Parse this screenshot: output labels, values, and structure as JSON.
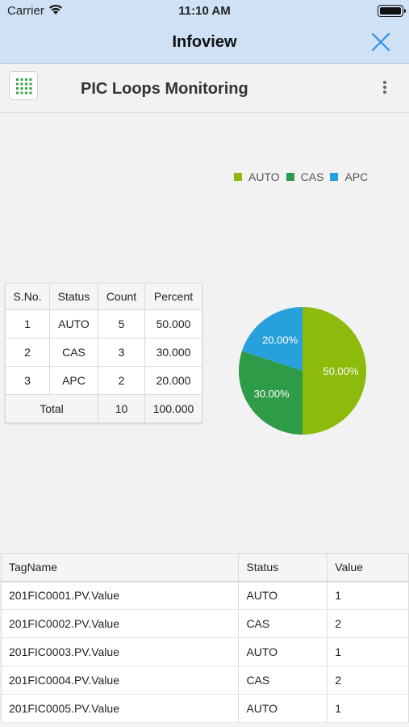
{
  "status_bar": {
    "carrier": "Carrier",
    "time": "11:10 AM"
  },
  "nav": {
    "title": "Infoview",
    "close_icon": "close-icon"
  },
  "header": {
    "title": "PIC Loops Monitoring",
    "grid_icon": "grid-icon",
    "more_icon": "more-vertical-icon"
  },
  "colors": {
    "auto": "#8dbb0b",
    "cas": "#2e9b48",
    "apc": "#27a0dc",
    "nav_bg": "#cfe1f5",
    "accent": "#2f8fe3"
  },
  "summary": {
    "headers": [
      "S.No.",
      "Status",
      "Count",
      "Percent"
    ],
    "rows": [
      {
        "sno": "1",
        "status": "AUTO",
        "count": "5",
        "percent": "50.000"
      },
      {
        "sno": "2",
        "status": "CAS",
        "count": "3",
        "percent": "30.000"
      },
      {
        "sno": "3",
        "status": "APC",
        "count": "2",
        "percent": "20.000"
      }
    ],
    "total": {
      "label": "Total",
      "count": "10",
      "percent": "100.000"
    }
  },
  "chart_data": {
    "type": "pie",
    "categories": [
      "AUTO",
      "CAS",
      "APC"
    ],
    "values": [
      50,
      30,
      20
    ],
    "labels": [
      "50.00%",
      "30.00%",
      "20.00%"
    ],
    "legend": "top",
    "colors": [
      "#8dbb0b",
      "#2e9b48",
      "#27a0dc"
    ]
  },
  "tags": {
    "headers": [
      "TagName",
      "Status",
      "Value"
    ],
    "rows": [
      {
        "name": "201FIC0001.PV.Value",
        "status": "AUTO",
        "value": "1"
      },
      {
        "name": "201FIC0002.PV.Value",
        "status": "CAS",
        "value": "2"
      },
      {
        "name": "201FIC0003.PV.Value",
        "status": "AUTO",
        "value": "1"
      },
      {
        "name": "201FIC0004.PV.Value",
        "status": "CAS",
        "value": "2"
      },
      {
        "name": "201FIC0005.PV.Value",
        "status": "AUTO",
        "value": "1"
      }
    ]
  }
}
